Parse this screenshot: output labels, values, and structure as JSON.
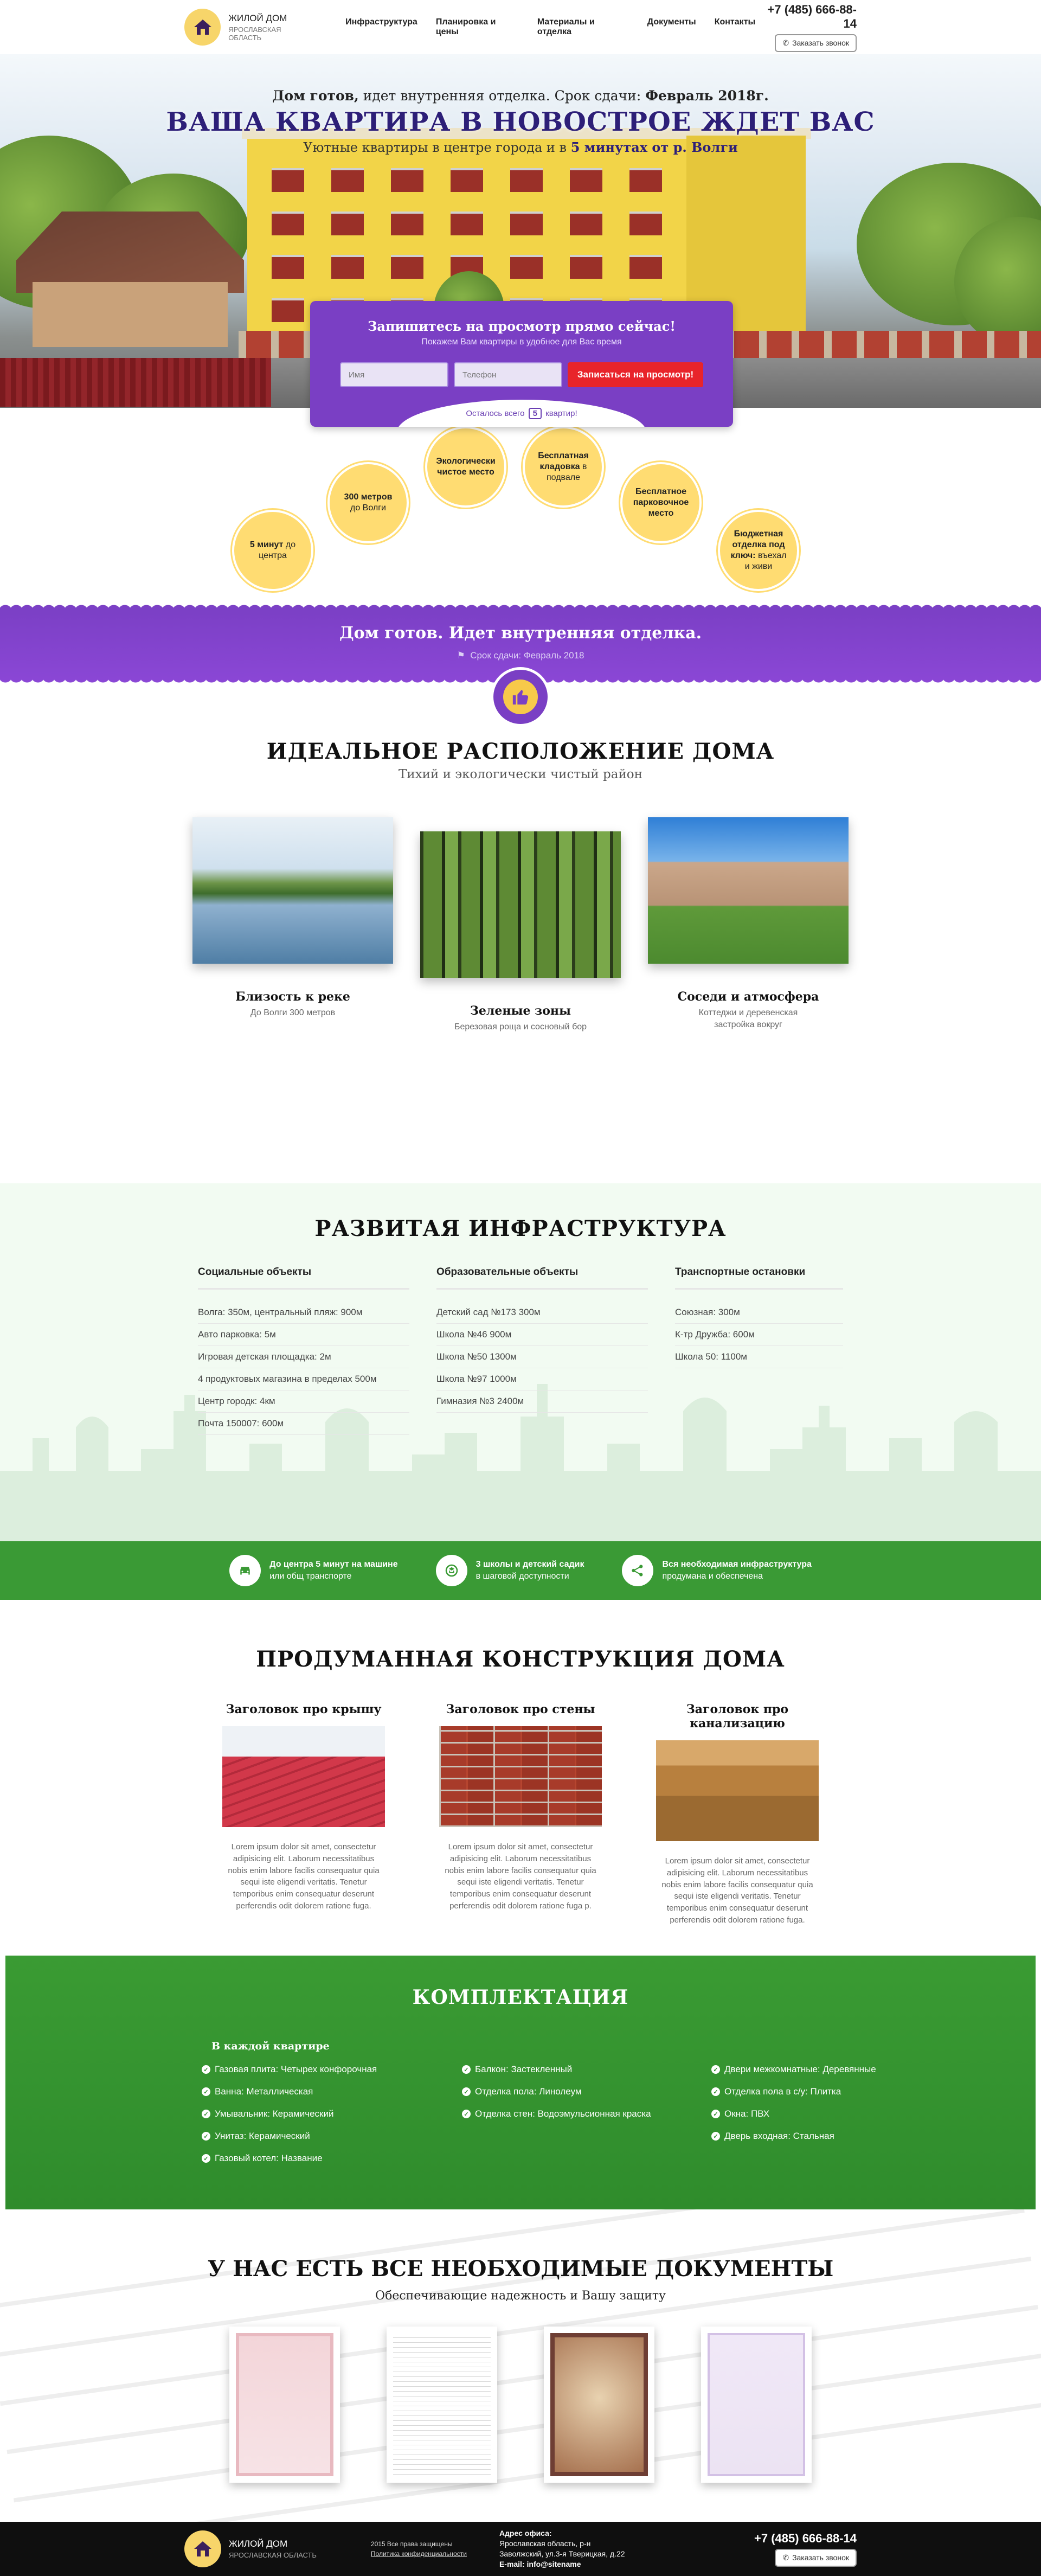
{
  "header": {
    "logo_title": "ЖИЛОЙ ДОМ",
    "logo_sub": "ЯРОСЛАВСКАЯ ОБЛАСТЬ",
    "nav": [
      "Инфраструктура",
      "Планировка и цены",
      "Материалы и отделка",
      "Документы",
      "Контакты"
    ],
    "phone": "+7 (485) 666-88-14",
    "callback": "Заказать звонок"
  },
  "hero": {
    "sub1_bold": "Дом готов,",
    "sub1_rest": " идет внутренняя отделка. Срок сдачи: ",
    "sub1_date": "Февраль 2018г.",
    "title": "ВАША КВАРТИРА В НОВОСТРОЕ ЖДЕТ ВАС",
    "sub2_start": "Уютные квартиры в центре города и в ",
    "sub2_bold": "5 минутах от р. Волги"
  },
  "form": {
    "title": "Запишитесь на просмотр прямо сейчас!",
    "subtitle": "Покажем Вам квартиры в удобное для Вас время",
    "name_placeholder": "Имя",
    "phone_placeholder": "Телефон",
    "submit": "Записаться на просмотр!",
    "remain_before": "Осталось всего",
    "remain_count": "5",
    "remain_after": "квартир!"
  },
  "features": [
    {
      "bold": "5 минут",
      "text": " до центра"
    },
    {
      "bold": "300 метров",
      "text": " до Волги"
    },
    {
      "bold": "Экологически чистое место",
      "text": ""
    },
    {
      "bold": "Бесплатная кладовка",
      "text": " в подвале"
    },
    {
      "bold": "Бесплатное парковочное место",
      "text": ""
    },
    {
      "bold": "Бюджетная отделка под ключ:",
      "text": " въехал и живи"
    }
  ],
  "status": {
    "title": "Дом готов. Идет внутренняя отделка.",
    "date": "Срок сдачи: Февраль 2018",
    "badge_icon": "thumbs-up-icon"
  },
  "location": {
    "title": "ИДЕАЛЬНОЕ РАСПОЛОЖЕНИЕ ДОМА",
    "subtitle": "Тихий и экологически чистый район",
    "cards": [
      {
        "name": "Близость к реке",
        "desc": "До Волги 300 метров"
      },
      {
        "name": "Зеленые зоны",
        "desc": "Березовая роща и сосновый бор"
      },
      {
        "name": "Соседи и атмосфера",
        "desc": "Коттеджи и деревенская застройка вокруг"
      }
    ]
  },
  "infra": {
    "title": "РАЗВИТАЯ ИНФРАСТРУКТУРА",
    "columns": [
      {
        "head": "Социальные объекты",
        "items": [
          "Волга: 350м, центральный пляж: 900м",
          "Авто парковка: 5м",
          "Игровая детская площадка: 2м",
          "4 продуктовых магазина в пределах 500м",
          "Центр городк: 4км",
          "Почта 150007: 600м"
        ]
      },
      {
        "head": "Образовательные объекты",
        "items": [
          "Детский сад №173 300м",
          "Школа №46 900м",
          "Школа №50 1300м",
          "Школа №97 1000м",
          "Гимназия №3 2400м"
        ]
      },
      {
        "head": "Транспортные остановки",
        "items": [
          "Союзная: 300м",
          "К-тр Дружба: 600м",
          "Школа 50: 1100м"
        ]
      }
    ],
    "strip": [
      {
        "bold": "До центра 5 минут на машине",
        "text": "или общ транспорте",
        "icon": "car-icon"
      },
      {
        "bold": "3 школы и детский садик",
        "text": "в шаговой доступности",
        "icon": "school-icon"
      },
      {
        "bold": "Вся необходимая инфраструктура",
        "text": "продумана и обеспечена",
        "icon": "share-icon"
      }
    ]
  },
  "construction": {
    "title": "ПРОДУМАННАЯ КОНСТРУКЦИЯ ДОМА",
    "columns": [
      {
        "head": "Заголовок про крышу",
        "text": "Lorem ipsum dolor sit amet, consectetur adipisicing elit. Laborum necessitatibus nobis enim labore facilis consequatur quia sequi iste eligendi veritatis. Tenetur temporibus enim consequatur deserunt perferendis odit dolorem ratione fuga."
      },
      {
        "head": "Заголовок про стены",
        "text": "Lorem ipsum dolor sit amet, consectetur adipisicing elit. Laborum necessitatibus nobis enim labore facilis consequatur quia sequi iste eligendi veritatis. Tenetur temporibus enim consequatur deserunt perferendis odit dolorem ratione fuga p."
      },
      {
        "head": "Заголовок про канализацию",
        "text": "Lorem ipsum dolor sit amet, consectetur adipisicing elit. Laborum necessitatibus nobis enim labore facilis consequatur quia sequi iste eligendi veritatis. Tenetur temporibus enim consequatur deserunt perferendis odit dolorem ratione fuga."
      }
    ]
  },
  "equipment": {
    "title": "КОМПЛЕКТАЦИЯ",
    "subtitle": "В каждой квартире",
    "columns": [
      [
        "Газовая плита: Четырех конфорочная",
        "Ванна: Металлическая",
        "Умывальник: Керамический",
        "Унитаз: Керамический",
        "Газовый котел: Название"
      ],
      [
        "Балкон: Застекленный",
        "Отделка пола: Линолеум",
        "Отделка стен: Водоэмульсионная краска"
      ],
      [
        "Двери межкомнатные: Деревянные",
        "Отделка пола в с/у: Плитка",
        "Окна: ПВХ",
        "Дверь входная: Стальная"
      ]
    ]
  },
  "documents": {
    "title": "У НАС ЕСТЬ ВСЕ НЕОБХОДИМЫЕ ДОКУМЕНТЫ",
    "subtitle": "Обеспечивающие надежность и Вашу защиту"
  },
  "footer": {
    "logo_title": "ЖИЛОЙ ДОМ",
    "logo_sub": "ЯРОСЛАВСКАЯ ОБЛАСТЬ",
    "copyright": "2015 Все права защищены",
    "privacy": "Политика конфиденциальности",
    "addr_label": "Адрес офиса:",
    "addr_line1": "Ярославская область, р-н",
    "addr_line2": "Заволжский, ул.3-я Тверицкая, д.22",
    "email": "E-mail: info@sitename",
    "phone": "+7 (485) 666-88-14",
    "callback": "Заказать звонок"
  },
  "colors": {
    "purple": "#7a3fc4",
    "yellow": "#ffdc72",
    "green": "#3a9a35",
    "red_button": "#e8242a",
    "dark_title": "#2d1f78"
  }
}
